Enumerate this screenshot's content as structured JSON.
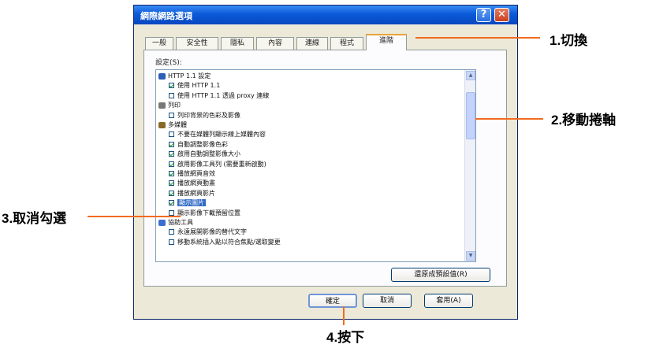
{
  "dialog": {
    "title": "網際網路選項",
    "help_glyph": "?",
    "close_glyph": "✕",
    "tabs": [
      {
        "label": "一般"
      },
      {
        "label": "安全性"
      },
      {
        "label": "隱私"
      },
      {
        "label": "內容"
      },
      {
        "label": "連線"
      },
      {
        "label": "程式"
      },
      {
        "label": "進階"
      }
    ],
    "active_tab": "進階",
    "settings_label": "設定(S):",
    "settings_items": [
      {
        "kind": "group",
        "label": "HTTP 1.1 設定",
        "icon": "globe-icon"
      },
      {
        "kind": "checkbox",
        "label": "使用 HTTP 1.1",
        "checked": true
      },
      {
        "kind": "checkbox",
        "label": "使用 HTTP 1.1 透過 proxy 連線",
        "checked": false
      },
      {
        "kind": "group",
        "label": "列印",
        "icon": "printer-icon"
      },
      {
        "kind": "checkbox",
        "label": "列印背景的色彩及影像",
        "checked": false
      },
      {
        "kind": "group",
        "label": "多媒體",
        "icon": "multimedia-icon"
      },
      {
        "kind": "checkbox",
        "label": "不要在媒體列顯示線上媒體內容",
        "checked": false
      },
      {
        "kind": "checkbox",
        "label": "自動調整影像色彩",
        "checked": true
      },
      {
        "kind": "checkbox",
        "label": "啟用自動調整影像大小",
        "checked": true
      },
      {
        "kind": "checkbox",
        "label": "啟用影像工具列 (需要重新啟動)",
        "checked": true
      },
      {
        "kind": "checkbox",
        "label": "播放網頁音效",
        "checked": true
      },
      {
        "kind": "checkbox",
        "label": "播放網頁動畫",
        "checked": true
      },
      {
        "kind": "checkbox",
        "label": "播放網頁影片",
        "checked": true
      },
      {
        "kind": "checkbox",
        "label": "顯示圖片",
        "checked": true,
        "selected": true
      },
      {
        "kind": "checkbox",
        "label": "顯示影像下載預留位置",
        "checked": false
      },
      {
        "kind": "group",
        "label": "協助工具",
        "icon": "accessibility-icon"
      },
      {
        "kind": "checkbox",
        "label": "永遠展開影像的替代文字",
        "checked": false
      },
      {
        "kind": "checkbox",
        "label": "移動系統插入點以符合焦點/選取變更",
        "checked": false
      }
    ],
    "restore_defaults_label": "還原成預設值(R)",
    "ok_label": "確定",
    "cancel_label": "取消",
    "apply_label": "套用(A)"
  },
  "annotations": {
    "step1": "1.切換",
    "step2": "2.移動捲軸",
    "step3": "3.取消勾選",
    "step4": "4.按下"
  },
  "colors": {
    "annotation_line": "#f26b1f",
    "titlebar": "#0a5ad8",
    "selection": "#316ac5"
  }
}
